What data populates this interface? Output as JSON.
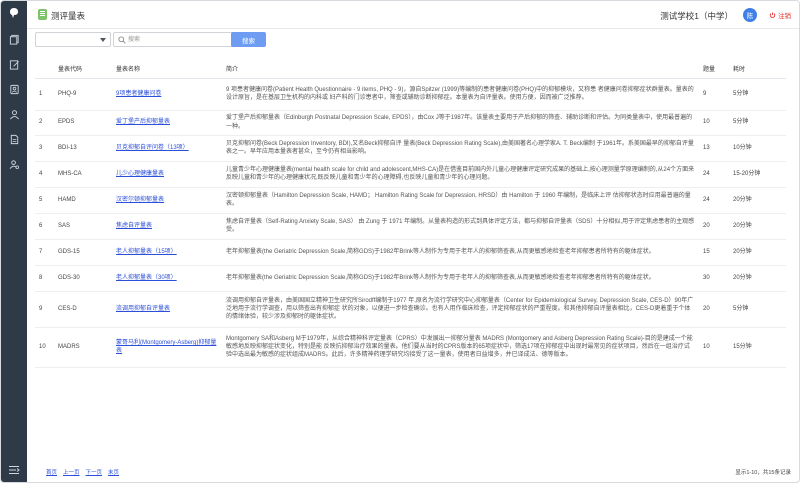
{
  "header": {
    "app_title": "测评量表",
    "school": "测试学校1（中学）",
    "avatar": "陈",
    "logout": "注销"
  },
  "search": {
    "placeholder": "搜索",
    "button": "搜索"
  },
  "table": {
    "columns": [
      "",
      "量表代码",
      "量表名称",
      "简介",
      "题量",
      "耗时"
    ],
    "rows": [
      {
        "no": "1",
        "code": "PHQ-9",
        "name": "9项患者健康问卷",
        "intro": "9 项患者健康问卷(Patient Health Questionnaire - 9 items, PHQ - 9)，源自Spitzer (1999)等编制的患者健康问卷(PHQ)中的抑郁模块，又称患 者健康问卷抑郁症状群量表。量表的设计原旨，是在基层卫生机构的内科或 妇产科的门诊患者中，筛查或辅助诊断抑郁症。本量表为自评量表。使用方便，因而被广泛推荐。",
        "items": "9",
        "time": "5分钟"
      },
      {
        "no": "2",
        "code": "EPDS",
        "name": "爱丁堡产后抑郁量表",
        "intro": "爱丁堡产后抑郁量表（Edinburgh Postnatal Depression Scale, EPDS），由Cox J等于1987年。该量表主要用于产后抑郁的筛查、辅助诊断和评估。为同类量表中，使用最普遍的一种。",
        "items": "10",
        "time": "5分钟"
      },
      {
        "no": "3",
        "code": "BDI-13",
        "name": "贝克抑郁自评问卷（13项）",
        "intro": "贝克抑郁问卷(Beck Depression Inventory, BDI),又名Beck抑郁自评 量表(Beck Depression Rating Scale),由美国著名心理学家A. T. Beck编制 于1961年。系美国最早的抑郁自评量表之一。早年应用本量表者甚众，至今仍有相当影响。",
        "items": "13",
        "time": "10分钟"
      },
      {
        "no": "4",
        "code": "MHS-CA",
        "name": "儿少心理健康量表",
        "intro": "儿童青少年心理健康量表(mental health scale for child and adolescent,MHS-CA)是在借鉴目前国内外儿童心理健康评定研究成果的基础上,按心理测量学原理编制的,从24个方面来反映儿童和青少年的心理健康状况,既反映儿童和青少年的心理障碍,也反映儿童和青少年的心理问题。",
        "items": "24",
        "time": "15-20分钟"
      },
      {
        "no": "5",
        "code": "HAMD",
        "name": "汉密尔顿抑郁量表",
        "intro": "汉密顿抑郁量表（Hamilton Depression Scale, HAMD； Hamilton Rating Scale for Depression, HRSD）由 Hamilton 于 1960 年编制，是临床上评 估抑郁状态时应用最普遍的量表。",
        "items": "24",
        "time": "20分钟"
      },
      {
        "no": "6",
        "code": "SAS",
        "name": "焦虑自评量表",
        "intro": "焦虑自评量表（Self-Rating Anxiety Scale, SAS） 由 Zung 于 1971 年编制。从量表构造的形式到具体评定方法，都与抑郁自评量表（SDS）十分相似,用于评定焦虑患者的主观感受。",
        "items": "20",
        "time": "20分钟"
      },
      {
        "no": "7",
        "code": "GDS-15",
        "name": "老人抑郁量表（15项）",
        "intro": "老年抑郁量表(the Geriatric Depression Scale,简称GDS)于1982年Brink等人制作为专用于老年人的抑郁筛查表,从而更敏感地检查老年抑郁患者所特有的躯体症状。",
        "items": "15",
        "time": "20分钟"
      },
      {
        "no": "8",
        "code": "GDS-30",
        "name": "老人抑郁量表（30项）",
        "intro": "老年抑郁量表(the Geriatric Depression Scale,简称GDS)于1982年Brink等人制作为专用于老年人的抑郁筛查表,从而更敏感地检查老年抑郁患者所特有的躯体症状。",
        "items": "30",
        "time": "20分钟"
      },
      {
        "no": "9",
        "code": "CES-D",
        "name": "流调用抑郁自评量表",
        "intro": "流调用抑郁自评量表，由美国国立精神卫生研究所Sirodff编制于1977 年,原名为流行学研究中心抑郁量表（Center for Epidemiological Survey, Depression Scale, CES-D）90年广泛地用于流行学调查，用以筛查出有抑郁症 状的对象，以便进一步检查确诊。也有人用作临床检查，评定抑郁症状的严重程度。和其他抑郁自评量表相比，CES-D更着重于个体的情绪体验，较少涉及抑郁时的躯体症状。",
        "items": "20",
        "time": "5分钟"
      },
      {
        "no": "10",
        "code": "MADRS",
        "name": "蒙哥马利(Montgomery-Asberg)抑郁量表",
        "intro": "Montgomery SA和Asberg M于1979年，从综合精神科评定量表（CPRS）中发展出一抑郁分量表 MADRS (Montgomery and Asberg Depression Rating Scale)-目的是建成一个能敏感地反映抑郁症状变化，特别是能 反映抗抑郁治疗效果的量表。他们要从当时的CPRS版本的65项症状中，筛选17项在抑郁症中出现时最常见的症状项目，然后在一组治疗试验中选出最为敏感的症状组成MADRS。此后，许多精神药理学研究均接受了这一量表，使用者日益增多，并已译成法、德等版本。",
        "items": "10",
        "time": "15分钟"
      }
    ]
  },
  "pager": {
    "first": "首页",
    "prev": "上一页",
    "next": "下一页",
    "last": "末页",
    "summary": "显示1-10，共15条记录"
  },
  "icons": {
    "accent": "#3f7fe8",
    "sidebar_bg": "#2e3a48",
    "search_button": "#6d9cf2",
    "logout_color": "#e0302b"
  }
}
